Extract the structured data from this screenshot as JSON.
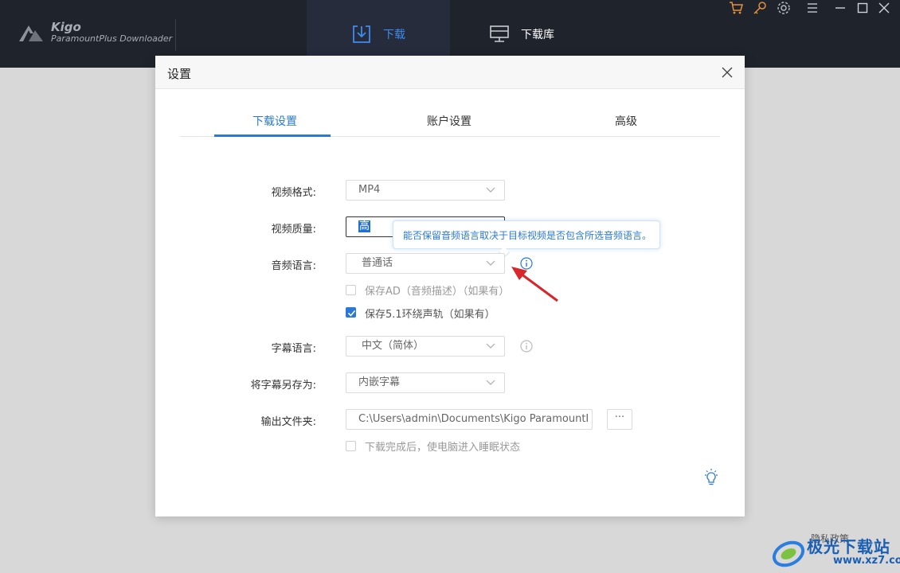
{
  "app": {
    "name": "Kigo",
    "subtitle": "ParamountPlus Downloader"
  },
  "nav": {
    "download": "下载",
    "library": "下载库"
  },
  "colors": {
    "accent": "#2a79d8",
    "titlebar": "#1f232b",
    "cart_icon": "#e8903a"
  },
  "dialog": {
    "title": "设置",
    "tabs": [
      "下载设置",
      "账户设置",
      "高级"
    ],
    "fields": {
      "video_format": {
        "label": "视频格式:",
        "value": "MP4"
      },
      "video_quality": {
        "label": "视频质量:",
        "value": "高"
      },
      "audio_language": {
        "label": "音频语言:",
        "value": "普通话"
      },
      "keep_ad": {
        "label": "保存AD（音频描述）（如果有）",
        "checked": false
      },
      "keep_51": {
        "label": "保存5.1环绕声轨（如果有）",
        "checked": true
      },
      "subtitle_language": {
        "label": "字幕语言:",
        "value": "中文（简体）"
      },
      "save_subtitle_as": {
        "label": "将字幕另存为:",
        "value": "内嵌字幕"
      },
      "output_folder": {
        "label": "输出文件夹:",
        "value": "C:\\Users\\admin\\Documents\\Kigo ParamountI",
        "browse": "···"
      },
      "sleep_after": {
        "label": "下载完成后，使电脑进入睡眠状态",
        "checked": false
      }
    },
    "tooltip": "能否保留音频语言取决于目标视频是否包含所选音频语言。"
  },
  "watermark": {
    "text": "极光下载站",
    "url": "www.xz7.com",
    "overlay": "隐私政策"
  }
}
